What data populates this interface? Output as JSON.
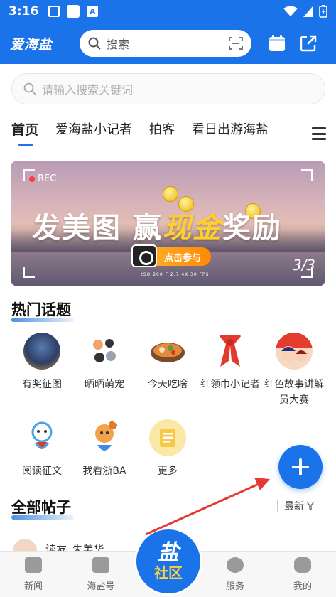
{
  "status_bar": {
    "time": "3:16",
    "notification_letter": "A"
  },
  "header": {
    "logo": "爱海盐",
    "search_placeholder": "搜索",
    "sign_in_label": "签"
  },
  "search_bar": {
    "placeholder": "请输入搜索关键词"
  },
  "tabs": [
    {
      "label": "首页",
      "active": true
    },
    {
      "label": "爱海盐小记者",
      "active": false
    },
    {
      "label": "拍客",
      "active": false
    },
    {
      "label": "看日出游海盐",
      "active": false
    }
  ],
  "banner": {
    "rec": "REC",
    "headline_left": "发美图 赢",
    "headline_gold": "现金",
    "headline_right": "奖励",
    "cta": "点击参与",
    "exif": "ISO 200   F 2.7   4K   30 FPS",
    "pager": "3/3"
  },
  "hot_topics": {
    "title": "热门话题",
    "items": [
      {
        "label": "有奖征图"
      },
      {
        "label": "晒晒萌宠"
      },
      {
        "label": "今天吃啥"
      },
      {
        "label": "红领巾小记者"
      },
      {
        "label": "红色故事讲解员大赛"
      },
      {
        "label": "阅读征文"
      },
      {
        "label": "我看浙BA"
      },
      {
        "label": "更多"
      }
    ]
  },
  "all_posts": {
    "title": "全部帖子",
    "sort": "最新",
    "first_post_author": "读友_朱美华"
  },
  "bottom_nav": {
    "items": [
      {
        "label": "新闻"
      },
      {
        "label": "海盐号"
      },
      {
        "label": "服务"
      },
      {
        "label": "我的"
      }
    ],
    "center_big": "盐",
    "center_small": "社区"
  },
  "colors": {
    "brand_blue": "#1a73e8",
    "gold": "#ffcf2e",
    "arrow_red": "#e53935"
  }
}
